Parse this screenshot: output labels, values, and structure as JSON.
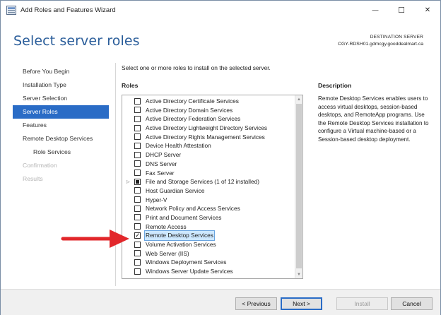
{
  "window": {
    "title": "Add Roles and Features Wizard",
    "minimize_glyph": "—",
    "maximize_glyph": "☐",
    "close_glyph": "✕"
  },
  "header": {
    "heading": "Select server roles",
    "destination_label": "DESTINATION SERVER",
    "destination_server": "CGY-RDSH01.gdmcgy.gooddealmart.ca"
  },
  "nav": {
    "items": [
      {
        "label": "Before You Begin",
        "state": "normal"
      },
      {
        "label": "Installation Type",
        "state": "normal"
      },
      {
        "label": "Server Selection",
        "state": "normal"
      },
      {
        "label": "Server Roles",
        "state": "active"
      },
      {
        "label": "Features",
        "state": "normal"
      },
      {
        "label": "Remote Desktop Services",
        "state": "normal"
      },
      {
        "label": "Role Services",
        "state": "sub"
      },
      {
        "label": "Confirmation",
        "state": "disabled"
      },
      {
        "label": "Results",
        "state": "disabled"
      }
    ]
  },
  "content": {
    "instruction": "Select one or more roles to install on the selected server.",
    "roles_heading": "Roles",
    "description_heading": "Description",
    "description_text": "Remote Desktop Services enables users to access virtual desktops, session-based desktops, and RemoteApp programs. Use the Remote Desktop Services installation to configure a Virtual machine-based or a Session-based desktop deployment."
  },
  "roles": [
    {
      "label": "Active Directory Certificate Services",
      "state": "unchecked"
    },
    {
      "label": "Active Directory Domain Services",
      "state": "unchecked"
    },
    {
      "label": "Active Directory Federation Services",
      "state": "unchecked"
    },
    {
      "label": "Active Directory Lightweight Directory Services",
      "state": "unchecked"
    },
    {
      "label": "Active Directory Rights Management Services",
      "state": "unchecked"
    },
    {
      "label": "Device Health Attestation",
      "state": "unchecked"
    },
    {
      "label": "DHCP Server",
      "state": "unchecked"
    },
    {
      "label": "DNS Server",
      "state": "unchecked"
    },
    {
      "label": "Fax Server",
      "state": "unchecked"
    },
    {
      "label": "File and Storage Services (1 of 12 installed)",
      "state": "partial",
      "expandable": true
    },
    {
      "label": "Host Guardian Service",
      "state": "unchecked"
    },
    {
      "label": "Hyper-V",
      "state": "unchecked"
    },
    {
      "label": "Network Policy and Access Services",
      "state": "unchecked"
    },
    {
      "label": "Print and Document Services",
      "state": "unchecked"
    },
    {
      "label": "Remote Access",
      "state": "unchecked"
    },
    {
      "label": "Remote Desktop Services",
      "state": "checked",
      "selected": true
    },
    {
      "label": "Volume Activation Services",
      "state": "unchecked"
    },
    {
      "label": "Web Server (IIS)",
      "state": "unchecked"
    },
    {
      "label": "Windows Deployment Services",
      "state": "unchecked"
    },
    {
      "label": "Windows Server Update Services",
      "state": "unchecked"
    }
  ],
  "icons": {
    "check_glyph": "✓",
    "expand_glyph": "▷",
    "scroll_up_glyph": "▲",
    "scroll_down_glyph": "▼"
  },
  "footer": {
    "previous_label": "< Previous",
    "next_label": "Next >",
    "install_label": "Install",
    "cancel_label": "Cancel"
  },
  "colors": {
    "accent": "#2a6cc6",
    "heading": "#2a5d9a",
    "annotation_arrow": "#e2272b"
  }
}
